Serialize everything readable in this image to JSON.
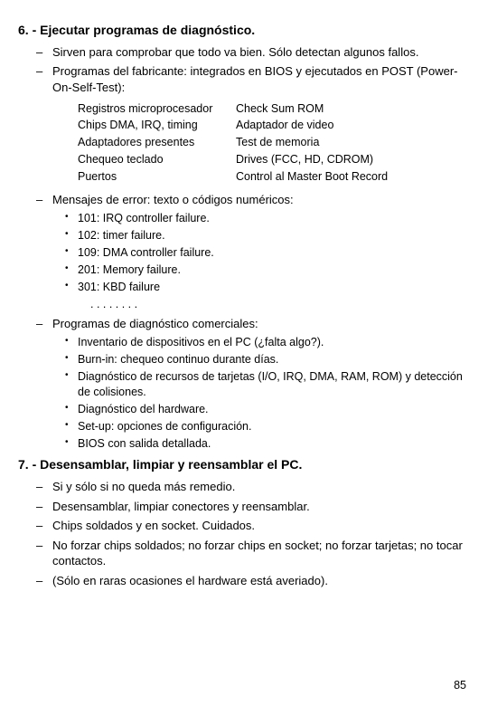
{
  "section6": {
    "heading": "6. - Ejecutar programas de diagnóstico.",
    "b1": "Sirven para comprobar que todo va bien. Sólo detectan algunos fallos.",
    "b2": "Programas del fabricante: integrados en BIOS y ejecutados en POST (Power-On-Self-Test):",
    "cols": {
      "left": [
        "Registros microprocesador",
        "Chips DMA, IRQ, timing",
        "Adaptadores presentes",
        "Chequeo teclado",
        "Puertos"
      ],
      "right": [
        "Check Sum ROM",
        "Adaptador de video",
        "Test de memoria",
        "Drives (FCC, HD, CDROM)",
        "Control al Master Boot Record"
      ]
    },
    "b3": "Mensajes de error: texto o códigos numéricos:",
    "errors": [
      "101: IRQ controller failure.",
      "102: timer failure.",
      "109: DMA controller failure.",
      "201: Memory failure.",
      "301: KBD failure"
    ],
    "ellipsis": ". . . . . . . .",
    "b4": "Programas de diagnóstico comerciales:",
    "commercial": [
      "Inventario de dispositivos en el PC (¿falta algo?).",
      "Burn-in: chequeo continuo durante días.",
      "Diagnóstico de recursos de tarjetas (I/O, IRQ, DMA, RAM, ROM) y detección de colisiones.",
      "Diagnóstico del hardware.",
      "Set-up: opciones de configuración.",
      "BIOS con salida detallada."
    ]
  },
  "section7": {
    "heading": "7. - Desensamblar, limpiar y reensamblar el PC.",
    "items": [
      "Si y sólo si no queda más remedio.",
      "Desensamblar, limpiar conectores y reensamblar.",
      "Chips soldados y en socket. Cuidados.",
      "No forzar chips soldados; no forzar chips en socket; no forzar tarjetas; no tocar contactos.",
      "(Sólo en raras ocasiones el hardware está averiado)."
    ]
  },
  "page": "85"
}
